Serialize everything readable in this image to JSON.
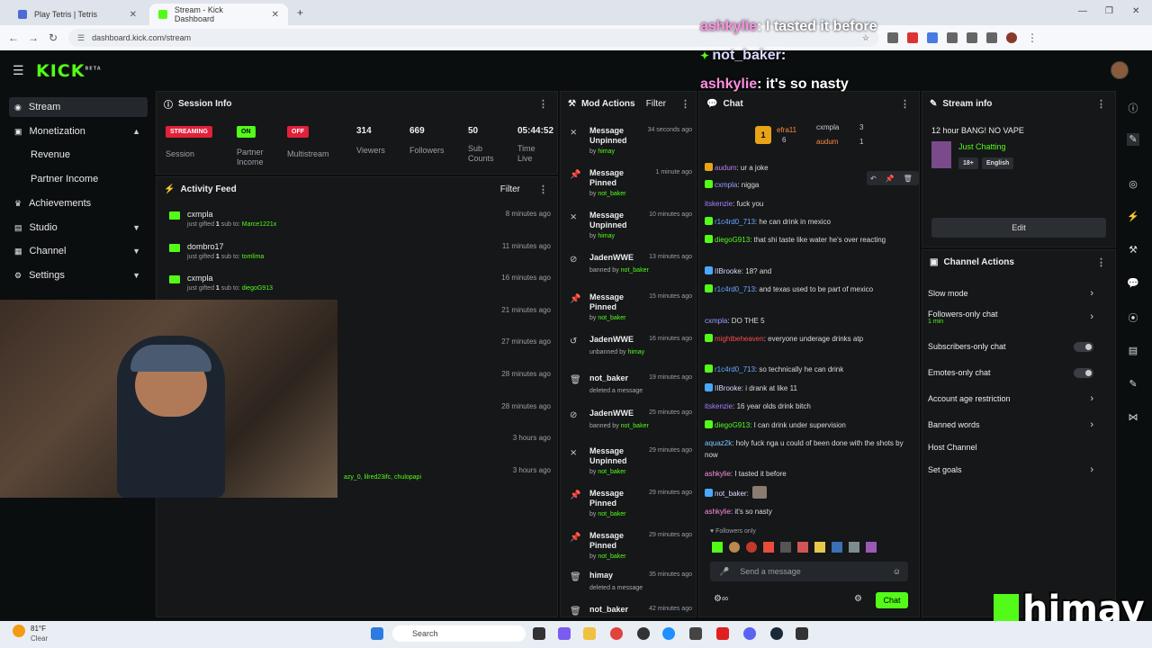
{
  "browser": {
    "tabs": [
      {
        "title": "Play Tetris | Tetris"
      },
      {
        "title": "Stream - Kick Dashboard"
      }
    ],
    "url": "dashboard.kick.com/stream"
  },
  "brand": {
    "logo": "KICK",
    "beta": "BETA",
    "accent": "#53fc18"
  },
  "sidebar": {
    "items": [
      {
        "label": "Stream",
        "icon": "play-icon"
      },
      {
        "label": "Monetization",
        "icon": "money-icon"
      },
      {
        "label": "Achievements",
        "icon": "trophy-icon"
      },
      {
        "label": "Studio",
        "icon": "studio-icon"
      },
      {
        "label": "Channel",
        "icon": "channel-icon"
      },
      {
        "label": "Settings",
        "icon": "gear-icon"
      }
    ],
    "sub_items": [
      "Revenue",
      "Partner Income"
    ]
  },
  "session": {
    "title": "Session Info",
    "streaming": "STREAMING",
    "session_label": "Session",
    "on": "ON",
    "partner_income": "Partner Income",
    "off": "OFF",
    "multistream": "Multistream",
    "viewers": "314",
    "viewers_label": "Viewers",
    "followers": "669",
    "followers_label": "Followers",
    "subs": "50",
    "subs_label": "Sub Counts",
    "time": "05:44:52",
    "time_label": "Time Live"
  },
  "activity": {
    "title": "Activity Feed",
    "filter": "Filter",
    "rows": [
      {
        "name": "cxmpla",
        "pre": "just gifted ",
        "num": "1",
        "mid": " sub to: ",
        "target": "Marce1221x",
        "time": "8 minutes ago"
      },
      {
        "name": "dombro17",
        "pre": "just gifted ",
        "num": "1",
        "mid": " sub to: ",
        "target": "tomlima",
        "time": "11 minutes ago"
      },
      {
        "name": "cxmpla",
        "pre": "just gifted ",
        "num": "1",
        "mid": " sub to: ",
        "target": "diegoG913",
        "time": "16 minutes ago"
      },
      {
        "time": "21 minutes ago"
      },
      {
        "time": "27 minutes ago"
      },
      {
        "time": "28 minutes ago"
      },
      {
        "time": "28 minutes ago"
      },
      {
        "time": "3 hours ago"
      },
      {
        "time": "3 hours ago",
        "target": "azy_0, lilred23ifc, chulopapi"
      }
    ]
  },
  "mod": {
    "title": "Mod Actions",
    "filter": "Filter",
    "rows": [
      {
        "title": "Message Unpinned",
        "time": "34 seconds ago",
        "by": "by ",
        "who": "himay",
        "icon": "unpin-icon"
      },
      {
        "title": "Message Pinned",
        "time": "1 minute ago",
        "by": "by ",
        "who": "not_baker",
        "icon": "pin-icon"
      },
      {
        "title": "Message Unpinned",
        "time": "10 minutes ago",
        "by": "by ",
        "who": "himay",
        "icon": "unpin-icon"
      },
      {
        "title": "JadenWWE",
        "time": "13 minutes ago",
        "by": "banned by ",
        "who": "not_baker",
        "icon": "ban-icon"
      },
      {
        "title": "Message Pinned",
        "time": "15 minutes ago",
        "by": "by ",
        "who": "not_baker",
        "icon": "pin-icon"
      },
      {
        "title": "JadenWWE",
        "time": "16 minutes ago",
        "by": "unbanned by ",
        "who": "himay",
        "icon": "unban-icon"
      },
      {
        "title": "not_baker",
        "time": "19 minutes ago",
        "by": "deleted a message",
        "who": "",
        "icon": "trash-icon"
      },
      {
        "title": "JadenWWE",
        "time": "25 minutes ago",
        "by": "banned by ",
        "who": "not_baker",
        "icon": "ban-icon"
      },
      {
        "title": "Message Unpinned",
        "time": "29 minutes ago",
        "by": "by ",
        "who": "not_baker",
        "icon": "unpin-icon"
      },
      {
        "title": "Message Pinned",
        "time": "29 minutes ago",
        "by": "by ",
        "who": "not_baker",
        "icon": "pin-icon"
      },
      {
        "title": "Message Pinned",
        "time": "29 minutes ago",
        "by": "by ",
        "who": "not_baker",
        "icon": "pin-icon"
      },
      {
        "title": "himay",
        "time": "35 minutes ago",
        "by": "deleted a message",
        "who": "",
        "icon": "trash-icon"
      },
      {
        "title": "not_baker",
        "time": "42 minutes ago",
        "by": "",
        "who": "",
        "icon": "trash-icon"
      }
    ]
  },
  "chat": {
    "title": "Chat",
    "top_gifter": {
      "rank": "1",
      "name": "efra11",
      "count": "6"
    },
    "gifters": [
      {
        "name": "cxmpla",
        "count": "3"
      },
      {
        "name": "audum",
        "count": "1"
      }
    ],
    "lines": [
      {
        "user": "audum",
        "color": "#c07cf0",
        "text": ": ur a joke"
      },
      {
        "user": "cxmpla",
        "color": "#9aa0ff",
        "text": ": nigga"
      },
      {
        "user": "itskenzie",
        "color": "#a882ff",
        "text": ": fuck you"
      },
      {
        "user": "r1c4rd0_713",
        "color": "#6aa8ff",
        "text": ": he can drink in mexico"
      },
      {
        "user": "diegoG913",
        "color": "#53fc18",
        "text": ": that shi taste like water he's over reacting"
      },
      {
        "user": "IIBrooke",
        "color": "#d9d9ff",
        "text": ": 18? and"
      },
      {
        "user": "r1c4rd0_713",
        "color": "#6aa8ff",
        "text": ": and texas used to be part of mexico"
      },
      {
        "user": "cxmpla",
        "color": "#9aa0ff",
        "text": ": DO THE 5"
      },
      {
        "user": "mightbeheaven",
        "color": "#ff4a4a",
        "text": ": everyone underage drinks atp"
      },
      {
        "user": "r1c4rd0_713",
        "color": "#6aa8ff",
        "text": ": so technically he can drink"
      },
      {
        "user": "IIBrooke",
        "color": "#d9d9ff",
        "text": ": i drank at like 11"
      },
      {
        "user": "itskenzie",
        "color": "#a882ff",
        "text": ": 16 year olds drink bitch"
      },
      {
        "user": "diegoG913",
        "color": "#53fc18",
        "text": ": I can drink under supervision"
      },
      {
        "user": "aquaz2k",
        "color": "#7ec8ff",
        "text": ": holy fuck nga u could of been done with the shots by now"
      },
      {
        "user": "ashkylie",
        "color": "#ff8fe0",
        "text": ": I tasted it before"
      },
      {
        "user": "not_baker",
        "color": "#d9d9ff",
        "text": ":"
      },
      {
        "user": "ashkylie",
        "color": "#ff8fe0",
        "text": ": it's so nasty"
      }
    ],
    "followers_only": "Followers only",
    "placeholder": "Send a message",
    "send": "Chat"
  },
  "stream_info": {
    "title": "Stream info",
    "stream_title": "12 hour BANG! NO VAPE",
    "category": "Just Chatting",
    "tags": [
      "18+",
      "English"
    ],
    "edit": "Edit"
  },
  "channel_actions": {
    "title": "Channel Actions",
    "rows": [
      {
        "label": "Slow mode",
        "kind": "chevron"
      },
      {
        "label": "Followers-only chat",
        "sub": "1 min",
        "kind": "chevron"
      },
      {
        "label": "Subscribers-only chat",
        "kind": "toggle"
      },
      {
        "label": "Emotes-only chat",
        "kind": "toggle"
      },
      {
        "label": "Account age restriction",
        "kind": "chevron"
      },
      {
        "label": "Banned words",
        "kind": "chevron"
      },
      {
        "label": "Host Channel",
        "kind": "none"
      },
      {
        "label": "Set goals",
        "kind": "chevron"
      }
    ]
  },
  "overlay": {
    "lines": [
      {
        "user": "ashkylie",
        "text": ": I tasted it before"
      },
      {
        "user": "not_baker",
        "text": ":"
      },
      {
        "user": "ashkylie",
        "text": ": it's so nasty"
      }
    ],
    "watermark": "himay"
  },
  "taskbar": {
    "temp": "81°F",
    "weather": "Clear",
    "search": "Search"
  }
}
